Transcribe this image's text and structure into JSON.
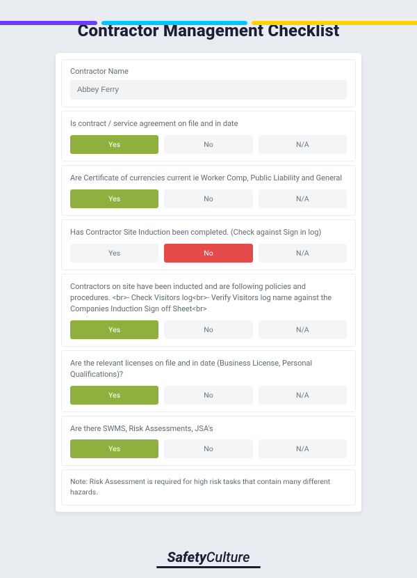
{
  "title": "Contractor Management Checklist",
  "contractor": {
    "label": "Contractor Name",
    "value": "Abbey Ferry"
  },
  "options": {
    "yes": "Yes",
    "no": "No",
    "na": "N/A"
  },
  "questions": [
    {
      "text": "Is contract / service agreement on file and in date",
      "selected": "yes"
    },
    {
      "text": "Are Certificate of currencies current ie Worker Comp, Public Liability and General",
      "selected": "yes"
    },
    {
      "text": "Has Contractor Site Induction been completed. (Check against Sign in log)",
      "selected": "no"
    },
    {
      "text": "Contractors on site have been inducted and are following policies and procedures. <br>- Check Visitors log<br>- Verify Visitors log name against the Companies Induction Sign off Sheet<br>",
      "selected": "yes"
    },
    {
      "text": "Are the relevant licenses on file and in date (Business License, Personal Qualifications)?",
      "selected": "yes"
    },
    {
      "text": "Are there SWMS, Risk Assessments, JSA's",
      "selected": "yes"
    }
  ],
  "note": "Note: Risk Assessment is required for high risk tasks that contain many different hazards.",
  "brand": {
    "bold": "Safety",
    "light": "Culture"
  }
}
